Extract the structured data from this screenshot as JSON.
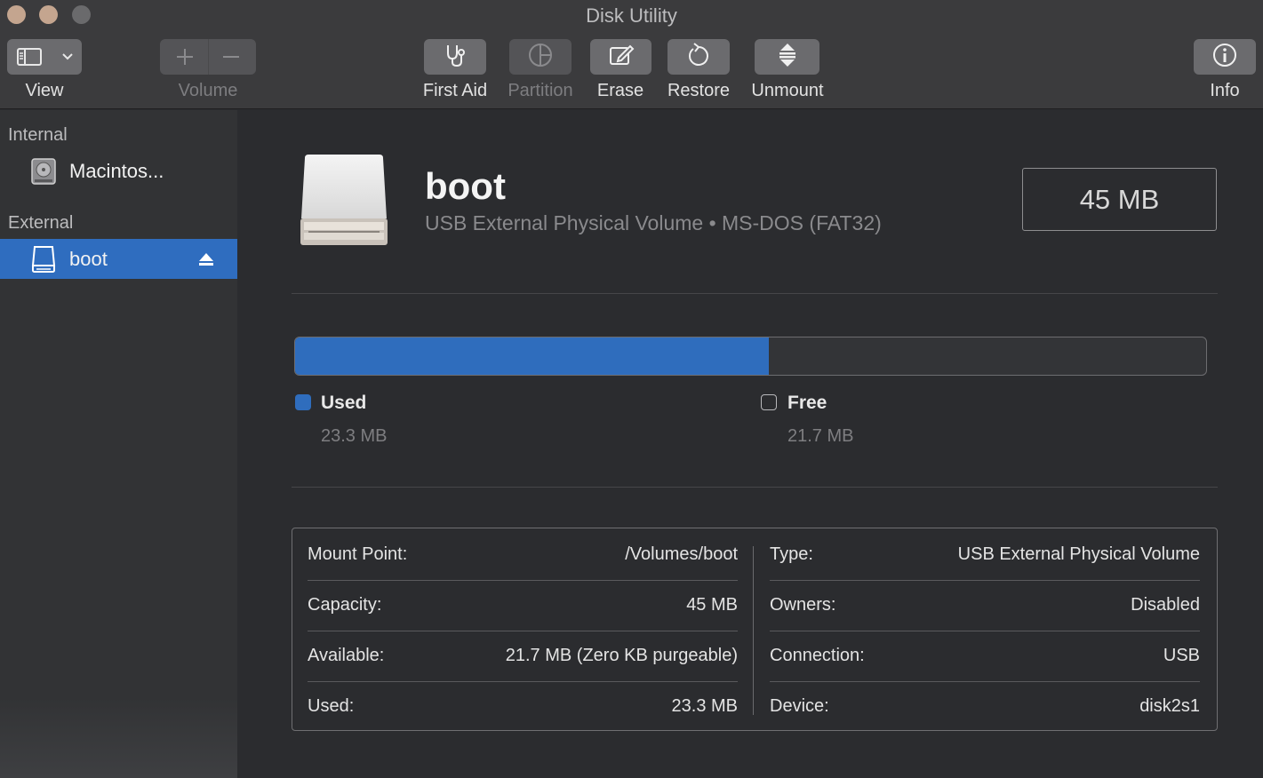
{
  "window": {
    "title": "Disk Utility"
  },
  "toolbar": {
    "view_label": "View",
    "volume_label": "Volume",
    "first_aid_label": "First Aid",
    "partition_label": "Partition",
    "erase_label": "Erase",
    "restore_label": "Restore",
    "unmount_label": "Unmount",
    "info_label": "Info"
  },
  "sidebar": {
    "internal_header": "Internal",
    "internal_items": [
      {
        "label": "Macintos...",
        "icon": "internal-disk-icon"
      }
    ],
    "external_header": "External",
    "external_items": [
      {
        "label": "boot",
        "icon": "external-drive-icon",
        "selected": true
      }
    ]
  },
  "volume": {
    "name": "boot",
    "subtitle": "USB External Physical Volume • MS-DOS (FAT32)",
    "size": "45 MB"
  },
  "usage": {
    "used_label": "Used",
    "used_value": "23.3 MB",
    "free_label": "Free",
    "free_value": "21.7 MB",
    "used_fraction": 0.52
  },
  "details": {
    "left": [
      {
        "label": "Mount Point:",
        "value": "/Volumes/boot"
      },
      {
        "label": "Capacity:",
        "value": "45 MB"
      },
      {
        "label": "Available:",
        "value": "21.7 MB (Zero KB purgeable)"
      },
      {
        "label": "Used:",
        "value": "23.3 MB"
      }
    ],
    "right": [
      {
        "label": "Type:",
        "value": "USB External Physical Volume"
      },
      {
        "label": "Owners:",
        "value": "Disabled"
      },
      {
        "label": "Connection:",
        "value": "USB"
      },
      {
        "label": "Device:",
        "value": "disk2s1"
      }
    ]
  },
  "colors": {
    "accent": "#2f6dbf",
    "used": "#2f6dbd",
    "background": "#2b2c2f",
    "sidebar": "#323335"
  }
}
